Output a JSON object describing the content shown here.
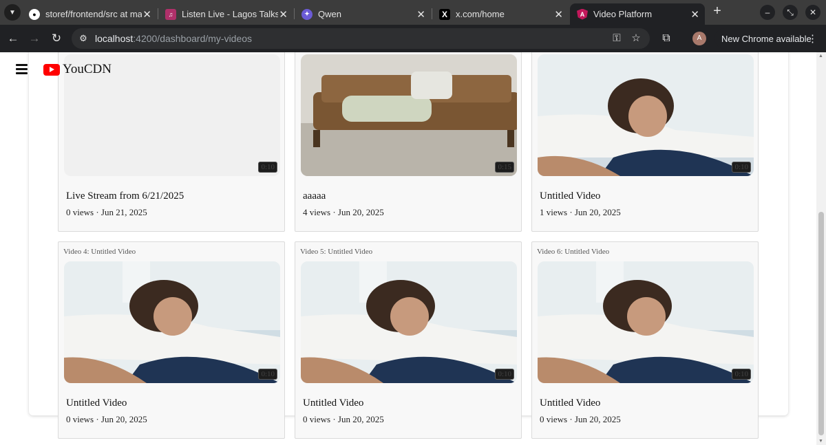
{
  "browser": {
    "tabs": [
      {
        "title": "storef/frontend/src at ma",
        "icon": "github-icon"
      },
      {
        "title": "Listen Live - Lagos Talks",
        "icon": "radio-icon"
      },
      {
        "title": "Qwen",
        "icon": "qwen-icon"
      },
      {
        "title": "x.com/home",
        "icon": "x-icon"
      },
      {
        "title": "Video Platform",
        "icon": "angular-icon",
        "active": true
      }
    ],
    "url_host": "localhost",
    "url_path": ":4200/dashboard/my-videos",
    "profile_initial": "A",
    "update_label": "New Chrome available"
  },
  "app": {
    "logo_text": "YouCDN"
  },
  "videos": [
    {
      "label": "",
      "title": "Live Stream from 6/21/2025",
      "meta": "0 views · Jun 21, 2025",
      "duration": "0:10",
      "thumb": "blank"
    },
    {
      "label": "",
      "title": "aaaaa",
      "meta": "4 views · Jun 20, 2025",
      "duration": "0:15",
      "thumb": "sofa"
    },
    {
      "label": "",
      "title": "Untitled Video",
      "meta": "1 views · Jun 20, 2025",
      "duration": "0:10",
      "thumb": "woman"
    },
    {
      "label": "Video 4: Untitled Video",
      "title": "Untitled Video",
      "meta": "0 views · Jun 20, 2025",
      "duration": "0:10",
      "thumb": "woman"
    },
    {
      "label": "Video 5: Untitled Video",
      "title": "Untitled Video",
      "meta": "0 views · Jun 20, 2025",
      "duration": "0:10",
      "thumb": "woman"
    },
    {
      "label": "Video 6: Untitled Video",
      "title": "Untitled Video",
      "meta": "0 views · Jun 20, 2025",
      "duration": "0:10",
      "thumb": "woman"
    }
  ]
}
